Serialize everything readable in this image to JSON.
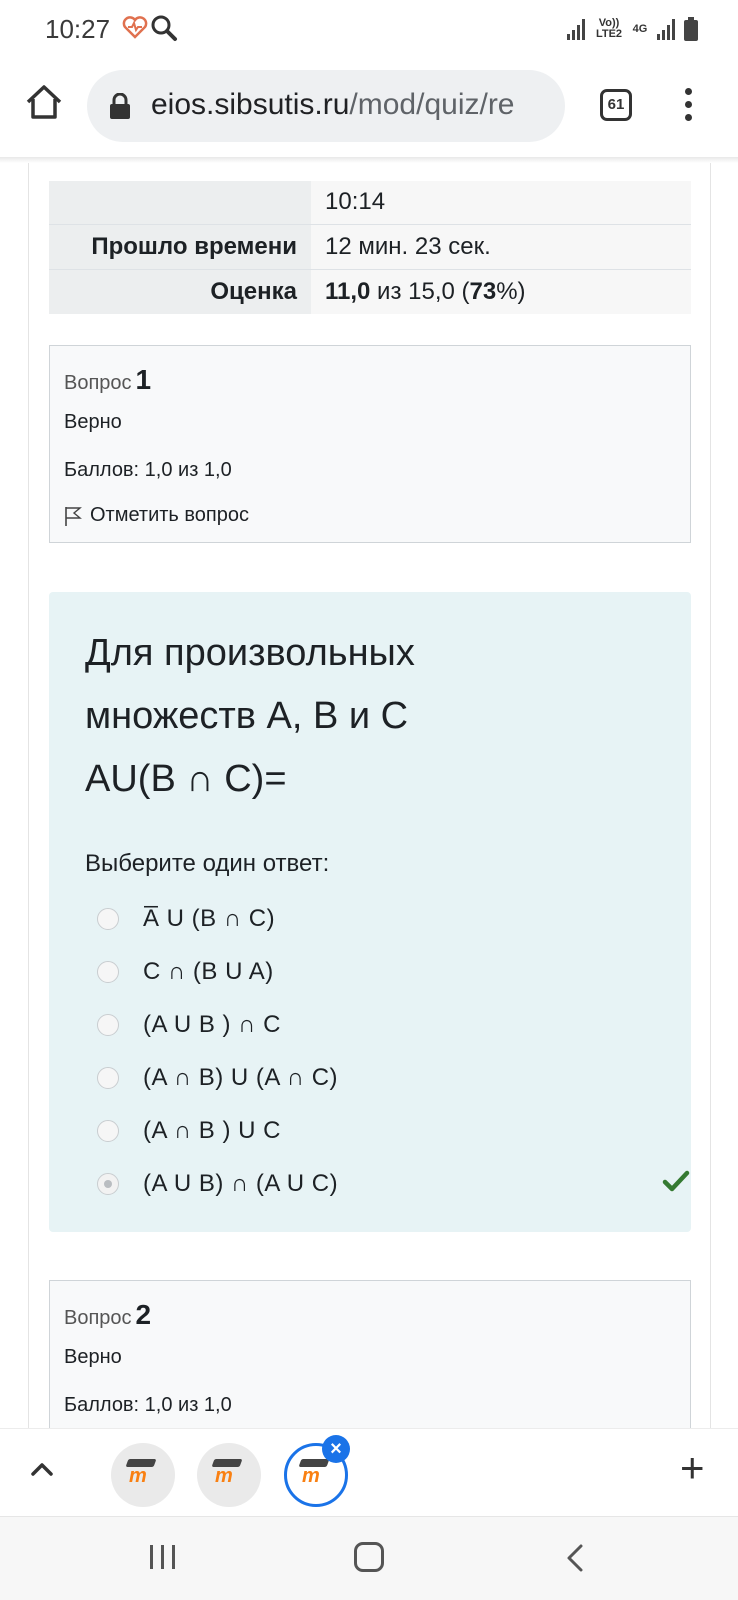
{
  "status_bar": {
    "time": "10:27",
    "volte_label": "Vo)) LTE2",
    "network_label": "4G",
    "icons": [
      "heart-icon",
      "search-icon",
      "signal-icon",
      "battery-icon"
    ]
  },
  "browser": {
    "url_host": "eios.sibsutis.ru",
    "url_path": "/mod/quiz/re",
    "tab_count": "61"
  },
  "summary": {
    "row_time_value": "10:14",
    "elapsed_label": "Прошло времени",
    "elapsed_value": "12 мин. 23 сек.",
    "grade_label": "Оценка",
    "grade_score": "11,0",
    "grade_middle": " из 15,0 (",
    "grade_percent": "73",
    "grade_end": "%)"
  },
  "question1": {
    "label": "Вопрос",
    "number": "1",
    "state": "Верно",
    "grade": "Баллов: 1,0 из 1,0",
    "flag_label": "Отметить вопрос",
    "text_line1": "Для произвольных",
    "text_line2": "множеств А, В и С",
    "text_line3": "AU(B ∩ C)=",
    "prompt": "Выберите один ответ:",
    "answers": [
      {
        "text": "A̅ U (B ∩ C)",
        "selected": false
      },
      {
        "text": "C ∩ (B U A)",
        "selected": false
      },
      {
        "text": "(A U B ) ∩ C",
        "selected": false
      },
      {
        "text": "(A ∩ B) U (A ∩ C)",
        "selected": false
      },
      {
        "text": "(A ∩ B ) U C",
        "selected": false
      },
      {
        "text": "(A U B) ∩ (A U C)",
        "selected": true
      }
    ],
    "correct_color": "#357a32"
  },
  "question2": {
    "label": "Вопрос",
    "number": "2",
    "state": "Верно",
    "grade": "Баллов: 1,0 из 1,0"
  },
  "tab_strip": {
    "tabs": [
      "moodle-tab",
      "moodle-tab",
      "moodle-tab-active"
    ],
    "close_badge": "×",
    "plus": "+",
    "accent": "#1a73e8"
  },
  "nav_bar": {
    "buttons": [
      "recents",
      "home",
      "back"
    ]
  }
}
